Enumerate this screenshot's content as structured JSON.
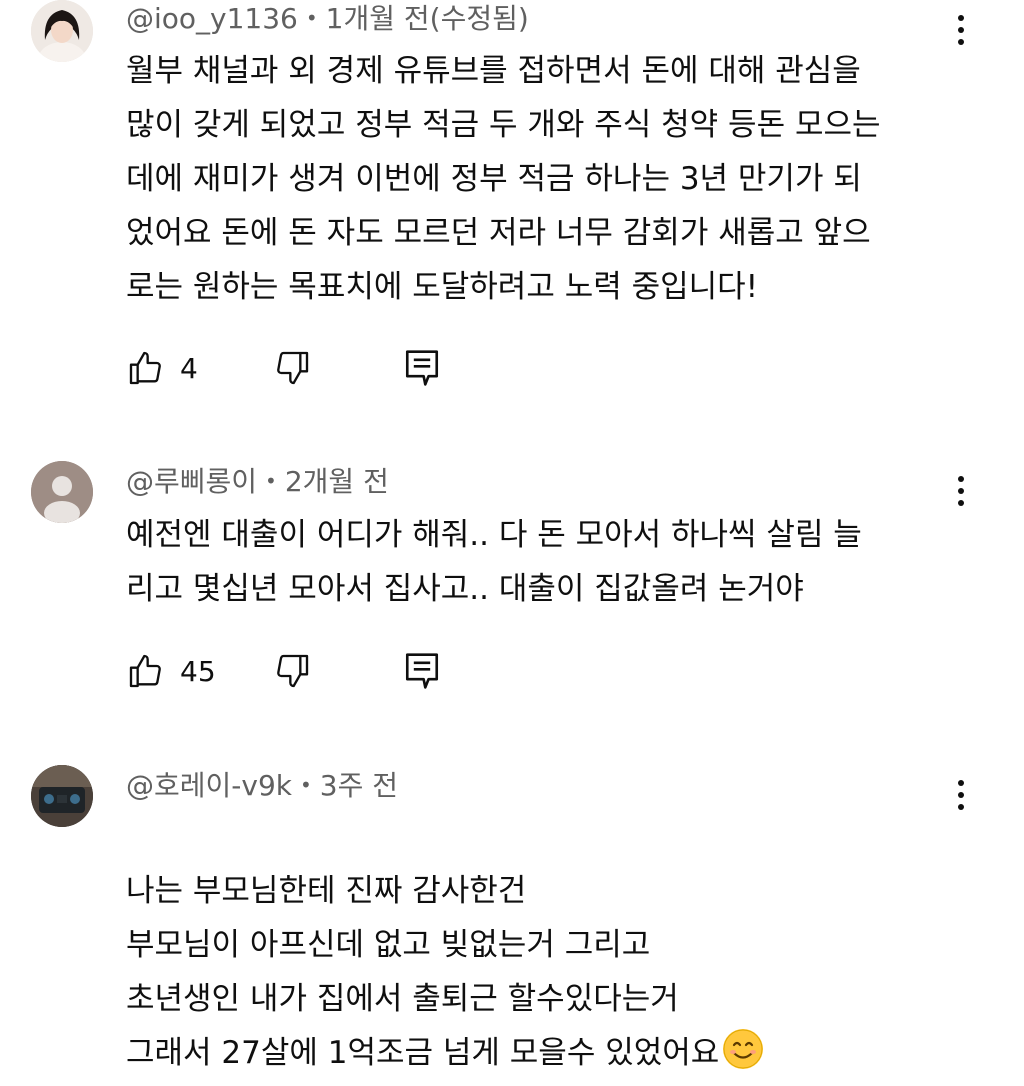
{
  "comments": [
    {
      "author": "@ioo_y1136",
      "time": "1개월 전(수정됨)",
      "text": "월부 채널과 외 경제 유튜브를 접하면서 돈에 대해 관심을\n많이 갖게 되었고 정부 적금 두 개와 주식 청약 등돈 모으는\n데에 재미가 생겨 이번에 정부 적금 하나는 3년 만기가 되\n었어요 돈에 돈 자도 모르던 저라 너무 감회가 새롭고 앞으\n로는 원하는 목표치에 도달하려고 노력 중입니다!",
      "likes": "4"
    },
    {
      "author": "@루삐롱이",
      "time": "2개월 전",
      "text": "예전엔 대출이 어디가 해줘.. 다 돈 모아서 하나씩 살림 늘\n리고 몇십년 모아서 집사고.. 대출이 집값올려 논거야",
      "likes": "45"
    },
    {
      "author": "@호레이-v9k",
      "time": "3주 전",
      "text": "나는 부모님한테 진짜 감사한건\n부모님이 아프신데 없고 빚없는거 그리고\n초년생인 내가 집에서 출퇴근 할수있다는거\n그래서 27살에 1억조금 넘게 모을수 있었어요",
      "emoji": "smiling-face",
      "likes": ""
    }
  ],
  "colors": {
    "text": "#0f0f0f",
    "meta": "#606060",
    "background": "#ffffff"
  }
}
